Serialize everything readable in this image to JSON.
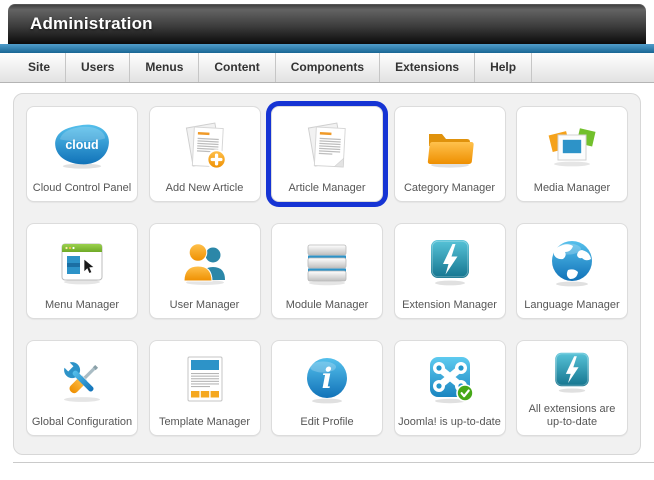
{
  "header": {
    "title": "Administration"
  },
  "menu": {
    "items": [
      {
        "label": "Site"
      },
      {
        "label": "Users"
      },
      {
        "label": "Menus"
      },
      {
        "label": "Content"
      },
      {
        "label": "Components"
      },
      {
        "label": "Extensions"
      },
      {
        "label": "Help"
      }
    ]
  },
  "panel": {
    "tiles": [
      {
        "label": "Cloud Control Panel",
        "icon": "cloud-icon",
        "highlighted": false
      },
      {
        "label": "Add New Article",
        "icon": "add-article-icon",
        "highlighted": false
      },
      {
        "label": "Article Manager",
        "icon": "article-icon",
        "highlighted": true
      },
      {
        "label": "Category Manager",
        "icon": "folder-icon",
        "highlighted": false
      },
      {
        "label": "Media Manager",
        "icon": "media-icon",
        "highlighted": false
      },
      {
        "label": "Menu Manager",
        "icon": "menu-window-icon",
        "highlighted": false
      },
      {
        "label": "User Manager",
        "icon": "users-icon",
        "highlighted": false
      },
      {
        "label": "Module Manager",
        "icon": "modules-icon",
        "highlighted": false
      },
      {
        "label": "Extension Manager",
        "icon": "lightning-icon",
        "highlighted": false
      },
      {
        "label": "Language Manager",
        "icon": "globe-icon",
        "highlighted": false
      },
      {
        "label": "Global Configuration",
        "icon": "tools-icon",
        "highlighted": false
      },
      {
        "label": "Template Manager",
        "icon": "template-icon",
        "highlighted": false
      },
      {
        "label": "Edit Profile",
        "icon": "info-icon",
        "highlighted": false
      },
      {
        "label": "Joomla! is up-to-date",
        "icon": "joomla-check-icon",
        "highlighted": false
      },
      {
        "label": "All extensions are up-to-date",
        "icon": "lightning-icon",
        "highlighted": false
      }
    ]
  },
  "colors": {
    "accent_blue": "#1f82bd",
    "highlight_border": "#1634d4",
    "header_text": "#ffffff",
    "tile_label": "#565656"
  }
}
